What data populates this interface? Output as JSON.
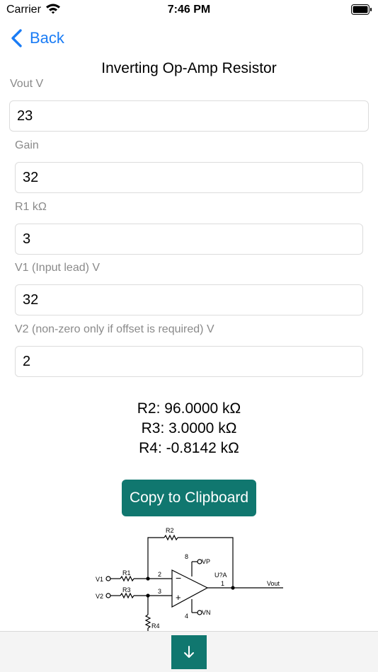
{
  "status_bar": {
    "carrier": "Carrier",
    "time": "7:46 PM",
    "icons": [
      "wifi-icon",
      "battery-icon"
    ]
  },
  "nav": {
    "back_label": "Back",
    "icon": "chevron-left-icon"
  },
  "title": "Inverting Op-Amp Resistor",
  "fields": {
    "vout": {
      "label": "Vout V",
      "value": "23"
    },
    "gain": {
      "label": "Gain",
      "value": "32"
    },
    "r1": {
      "label": "R1 kΩ",
      "value": "3"
    },
    "v1": {
      "label": "V1 (Input lead) V",
      "value": "32"
    },
    "v2": {
      "label": "V2 (non-zero only if offset is required) V",
      "value": "2"
    }
  },
  "results": {
    "r2": "R2: 96.0000 kΩ",
    "r3": "R3: 3.0000 kΩ",
    "r4": "R4: -0.8142 kΩ"
  },
  "copy_button": "Copy to Clipboard",
  "diagram": {
    "r2": "R2",
    "r1": "R1",
    "r3": "R3",
    "r4": "R4",
    "v1": "V1",
    "v2": "V2",
    "vout": "Vout",
    "vp": "VP",
    "vn": "VN",
    "part": "U?A",
    "pin8": "8",
    "pin2": "2",
    "pin3": "3",
    "pin4": "4",
    "pin1": "1",
    "minus": "−",
    "plus": "+"
  },
  "bottom_bar": {
    "icon": "arrow-down-icon"
  },
  "colors": {
    "accent": "#10776f",
    "link": "#1a7cf5",
    "label": "#8a8a8a"
  }
}
